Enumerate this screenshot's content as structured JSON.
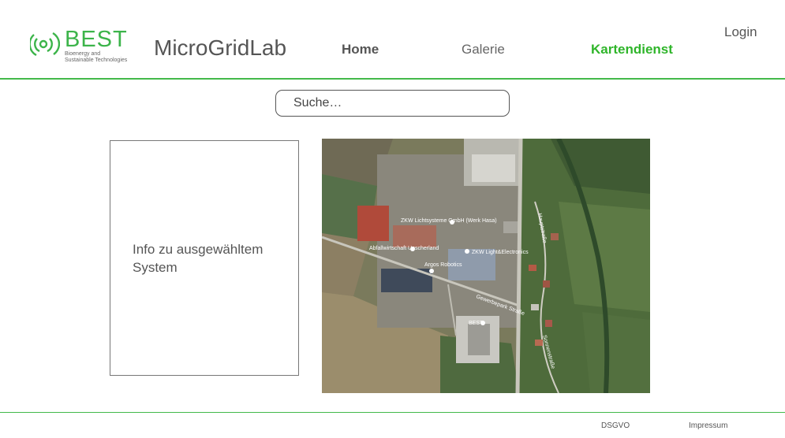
{
  "brand": {
    "name": "BEST",
    "subtitle_line1": "Bioenergy and",
    "subtitle_line2": "Sustainable Technologies",
    "accent": "#3cb44a"
  },
  "header": {
    "app_title": "MicroGridLab",
    "nav": [
      {
        "label": "Home",
        "active": false
      },
      {
        "label": "Galerie",
        "active": false
      },
      {
        "label": "Kartendienst",
        "active": true
      }
    ],
    "login_label": "Login",
    "active_color": "#2fb52a"
  },
  "search": {
    "placeholder": "Suche…"
  },
  "info_panel": {
    "text_line1": "Info zu ausgewähltem",
    "text_line2": "System"
  },
  "map": {
    "labels": [
      "ZKW Lichtsysteme GmbH (Werk Hasa)",
      "ZKW Light&Electronics",
      "Abfallwirtschaft Unscherland",
      "Argos Robotics",
      "BEST",
      "Gewerbepark Straße",
      "Hauptstraße",
      "Sonnenstraße"
    ]
  },
  "footer": {
    "dsgvo_label": "DSGVO",
    "impressum_label": "Impressum"
  }
}
